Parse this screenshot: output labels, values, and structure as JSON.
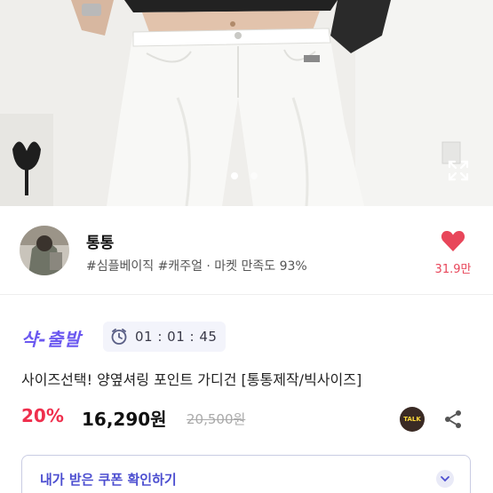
{
  "gallery": {
    "current_index": 1,
    "total": 2
  },
  "shop": {
    "name": "통통",
    "tags": "#심플베이직 #캐주얼 · 마켓 만족도 93%",
    "likes": "31.9만"
  },
  "promo": {
    "badge": "샥-출발",
    "countdown": "01 : 01 : 45"
  },
  "product": {
    "title": "사이즈선택! 양옆셔링 포인트 가디건 [통통제작/빅사이즈]",
    "discount": "20%",
    "price": "16,290원",
    "original_price": "20,500원",
    "talk_label": "TALK"
  },
  "coupon": {
    "label": "내가 받은 쿠폰 확인하기"
  },
  "colors": {
    "accent": "#6b58f0",
    "discount": "#ef2f4d",
    "heart": "#e8465a",
    "coupon_text": "#4c4ed0"
  },
  "icons": [
    "expand-icon",
    "heart-icon",
    "clock-icon",
    "talk-icon",
    "share-icon",
    "chevron-down-icon"
  ]
}
